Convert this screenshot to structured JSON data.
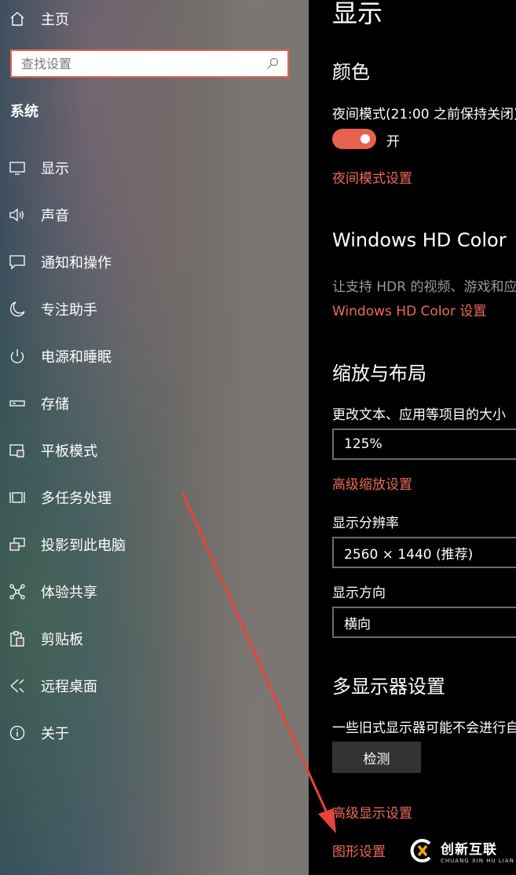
{
  "sidebar": {
    "home_label": "主页",
    "search_placeholder": "查找设置",
    "section_title": "系统",
    "items": [
      {
        "label": "显示",
        "icon": "monitor-icon"
      },
      {
        "label": "声音",
        "icon": "speaker-icon"
      },
      {
        "label": "通知和操作",
        "icon": "notification-icon"
      },
      {
        "label": "专注助手",
        "icon": "moon-icon"
      },
      {
        "label": "电源和睡眠",
        "icon": "power-icon"
      },
      {
        "label": "存储",
        "icon": "storage-icon"
      },
      {
        "label": "平板模式",
        "icon": "tablet-icon"
      },
      {
        "label": "多任务处理",
        "icon": "multitask-icon"
      },
      {
        "label": "投影到此电脑",
        "icon": "project-icon"
      },
      {
        "label": "体验共享",
        "icon": "share-icon"
      },
      {
        "label": "剪贴板",
        "icon": "clipboard-icon"
      },
      {
        "label": "远程桌面",
        "icon": "remote-desktop-icon"
      },
      {
        "label": "关于",
        "icon": "info-icon"
      }
    ]
  },
  "main": {
    "page_title": "显示",
    "color_section": {
      "title": "颜色",
      "night_mode_label": "夜间模式(21:00 之前保持关闭)",
      "toggle_state": "开",
      "night_mode_link": "夜间模式设置"
    },
    "hdr_section": {
      "title": "Windows HD Color",
      "description": "让支持 HDR 的视频、游戏和应",
      "link": "Windows HD Color 设置"
    },
    "scale_section": {
      "title": "缩放与布局",
      "scale_label": "更改文本、应用等项目的大小",
      "scale_value": "125%",
      "advanced_scale_link": "高级缩放设置",
      "resolution_label": "显示分辨率",
      "resolution_value": "2560 × 1440 (推荐)",
      "orientation_label": "显示方向",
      "orientation_value": "横向"
    },
    "multi_display_section": {
      "title": "多显示器设置",
      "description": "一些旧式显示器可能不会进行自",
      "detect_button": "检测",
      "advanced_display_link": "高级显示设置",
      "graphics_link": "图形设置"
    }
  },
  "watermark": {
    "name": "创新互联",
    "pinyin": "CHUANG XIN HU LIAN"
  },
  "colors": {
    "accent": "#e8604e",
    "link": "#ee6a5a",
    "arrow": "#e8433a",
    "main_bg": "#000000"
  }
}
